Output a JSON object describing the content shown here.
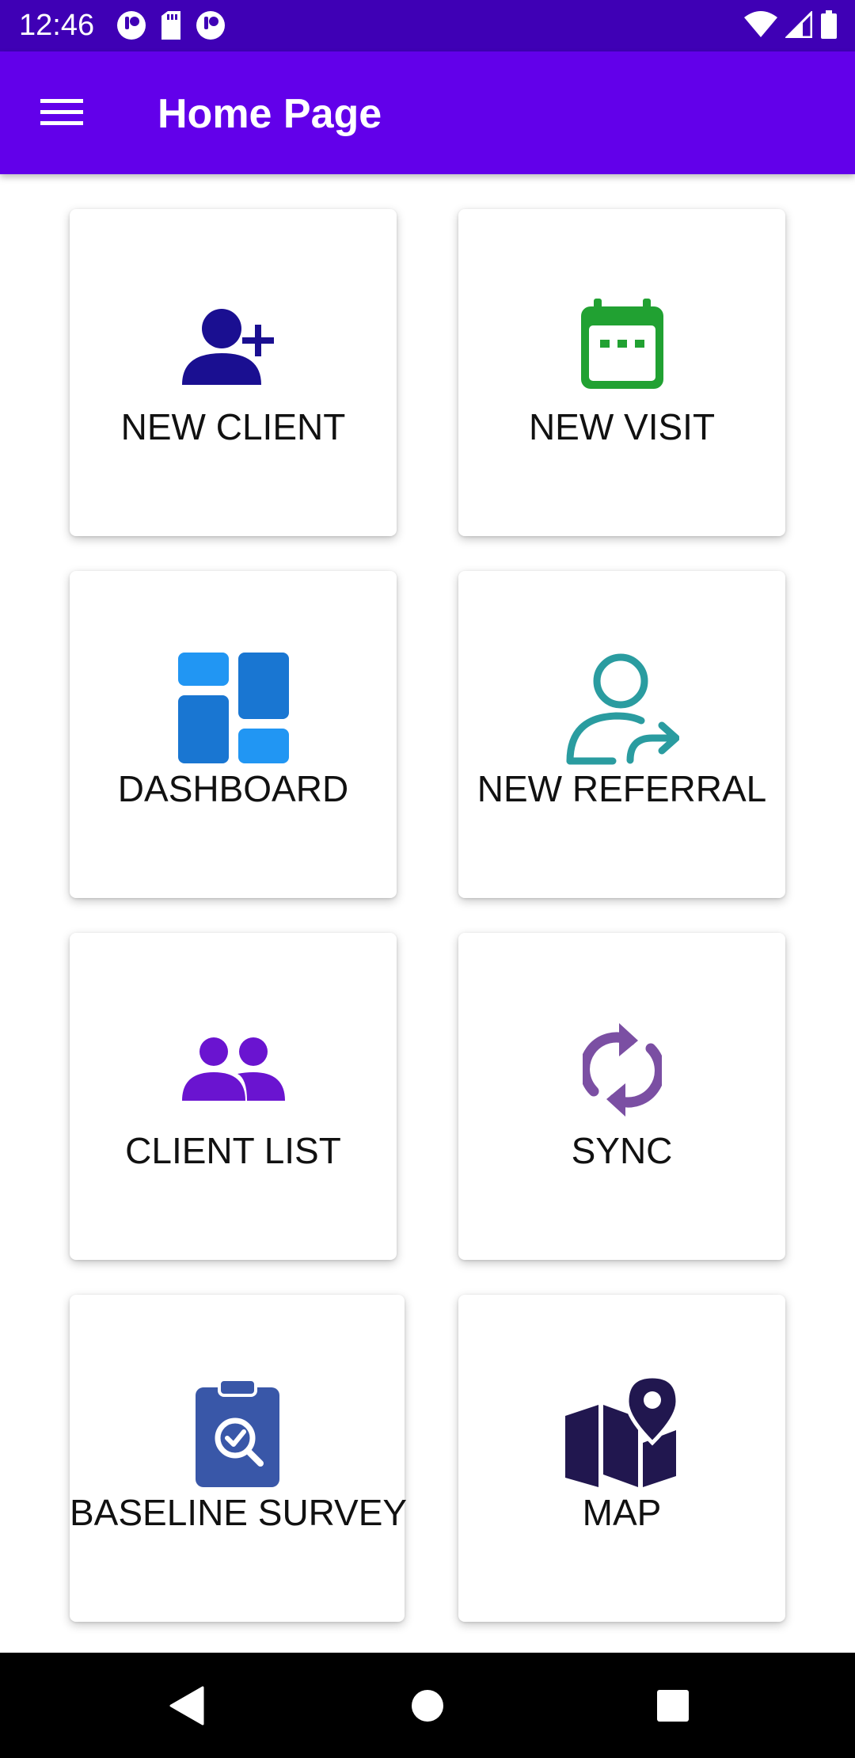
{
  "status_bar": {
    "time": "12:46",
    "left_icons": [
      "notification-app-icon",
      "sd-card-icon",
      "notification-app-icon"
    ],
    "right_icons": [
      "wifi-icon",
      "signal-icon",
      "battery-icon"
    ]
  },
  "app_bar": {
    "title": "Home Page",
    "menu_icon": "hamburger-menu-icon",
    "background": "#6200ea"
  },
  "tiles": [
    {
      "label": "NEW CLIENT",
      "icon": "add-person-icon",
      "color": "#1a0f91"
    },
    {
      "label": "NEW VISIT",
      "icon": "calendar-icon",
      "color": "#21a132"
    },
    {
      "label": "DASHBOARD",
      "icon": "dashboard-icon",
      "color": "#1e88e5"
    },
    {
      "label": "NEW REFERRAL",
      "icon": "person-forward-icon",
      "color": "#2a9ca0"
    },
    {
      "label": "CLIENT LIST",
      "icon": "people-icon",
      "color": "#6a14d0"
    },
    {
      "label": "SYNC",
      "icon": "sync-icon",
      "color": "#7b4fa3"
    },
    {
      "label": "BASELINE SURVEY",
      "icon": "clipboard-search-icon",
      "color": "#3957a8"
    },
    {
      "label": "MAP",
      "icon": "map-pin-icon",
      "color": "#21174f"
    }
  ],
  "nav_bar": {
    "buttons": [
      "back-icon",
      "home-icon",
      "recents-icon"
    ]
  }
}
